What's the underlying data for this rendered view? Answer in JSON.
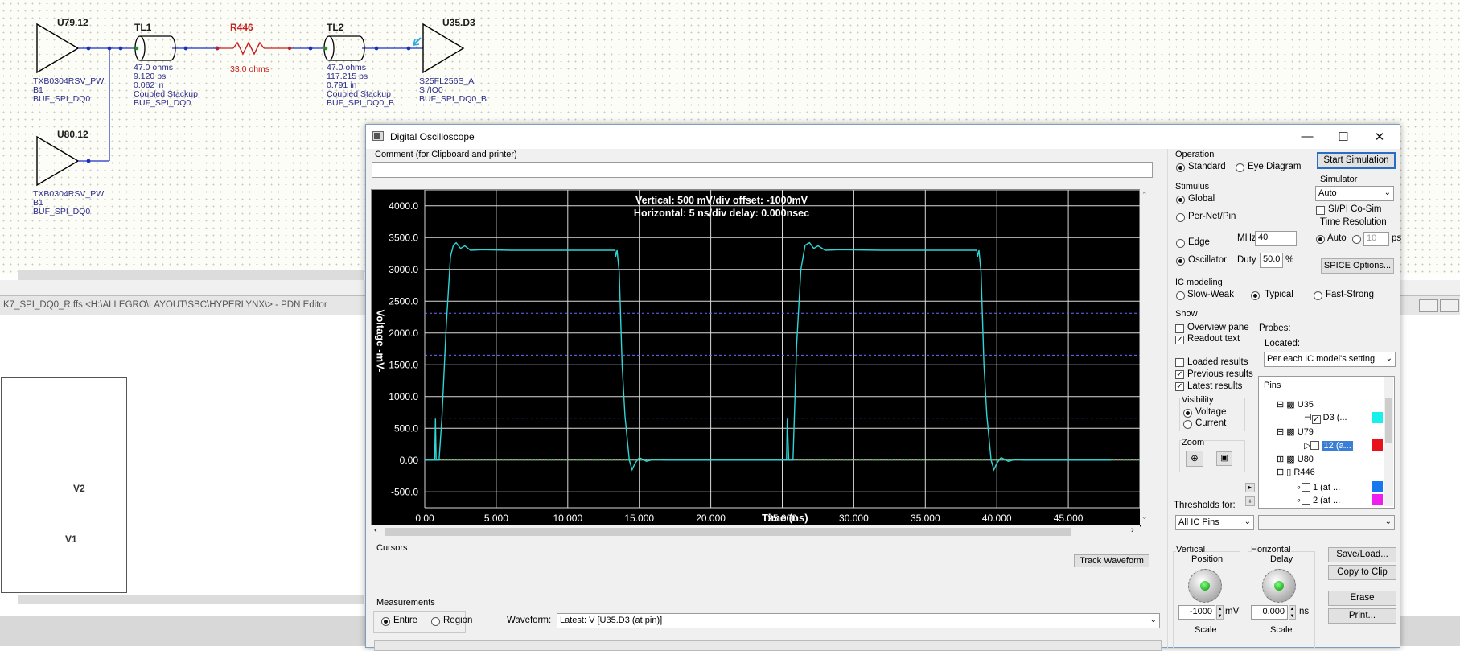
{
  "schematic": {
    "u79": {
      "ref": "U79.12",
      "model": "TXB0304RSV_PW",
      "pin": "B1",
      "net": "BUF_SPI_DQ0"
    },
    "u80": {
      "ref": "U80.12",
      "model": "TXB0304RSV_PW",
      "pin": "B1",
      "net": "BUF_SPI_DQ0"
    },
    "tl1": {
      "ref": "TL1",
      "impedance": "47.0 ohms",
      "delay": "9.120 ps",
      "length": "0.062 in",
      "type": "Coupled Stackup",
      "net": "BUF_SPI_DQ0"
    },
    "r446": {
      "ref": "R446",
      "value": "33.0 ohms"
    },
    "tl2": {
      "ref": "TL2",
      "impedance": "47.0 ohms",
      "delay": "117.215 ps",
      "length": "0.791 in",
      "type": "Coupled Stackup",
      "net": "BUF_SPI_DQ0_B"
    },
    "u35": {
      "ref": "U35.D3",
      "model": "S25FL256S_A",
      "pin": "SI/IO0",
      "net": "BUF_SPI_DQ0_B"
    }
  },
  "pdn_editor": {
    "title": "K7_SPI_DQ0_R.ffs <H:\\ALLEGRO\\LAYOUT\\SBC\\HYPERLYNX\\> - PDN Editor",
    "labels": [
      "V2",
      "V1"
    ]
  },
  "oscilloscope": {
    "title": "Digital Oscilloscope",
    "comment_label": "Comment (for Clipboard and printer)",
    "comment_value": "",
    "scope": {
      "vertical_readout": "Vertical: 500 mV/div  offset: -1000mV",
      "horizontal_readout": "Horizontal: 5 ns/div  delay: 0.000nsec",
      "ylabel": "Voltage  -mV-",
      "xlabel": "Time  (ns)"
    },
    "operation": {
      "label": "Operation",
      "standard": "Standard",
      "eye": "Eye Diagram"
    },
    "start_button": "Start Simulation",
    "simulator": {
      "label": "Simulator",
      "value": "Auto",
      "sipi": "SI/PI Co-Sim",
      "time_res_label": "Time Resolution",
      "auto": "Auto",
      "ps_value": "10",
      "ps_unit": "ps",
      "spice_button": "SPICE Options..."
    },
    "stimulus": {
      "label": "Stimulus",
      "global": "Global",
      "per_net": "Per-Net/Pin",
      "edge": "Edge",
      "oscillator": "Oscillator",
      "mhz_label": "MHz",
      "mhz_value": "40",
      "duty_label": "Duty",
      "duty_value": "50.0",
      "duty_unit": "%"
    },
    "ic_modeling": {
      "label": "IC modeling",
      "slow": "Slow-Weak",
      "typical": "Typical",
      "fast": "Fast-Strong"
    },
    "show": {
      "label": "Show",
      "overview": "Overview pane",
      "readout": "Readout text",
      "loaded": "Loaded results",
      "previous": "Previous results",
      "latest": "Latest results"
    },
    "probes": {
      "label": "Probes:",
      "located_label": "Located:",
      "located_value": "Per each IC model's setting",
      "pins_header": "Pins"
    },
    "tree": [
      {
        "text": "U35"
      },
      {
        "text": "D3 (..."
      },
      {
        "text": "U79"
      },
      {
        "text": "12 (a..."
      },
      {
        "text": "U80"
      },
      {
        "text": "R446"
      },
      {
        "text": "1 (at ..."
      },
      {
        "text": "2 (at ..."
      }
    ],
    "visibility": {
      "label": "Visibility",
      "voltage": "Voltage",
      "current": "Current"
    },
    "zoom_label": "Zoom",
    "thresholds": {
      "label": "Thresholds for:",
      "value": "All IC Pins"
    },
    "cursors": {
      "label": "Cursors",
      "track_button": "Track Waveform"
    },
    "measurements": {
      "label": "Measurements",
      "entire": "Entire",
      "region": "Region",
      "waveform_label": "Waveform:",
      "waveform_value": "Latest: V [U35.D3 (at pin)]"
    },
    "vertical": {
      "label1": "Vertical",
      "label2": "Position",
      "value": "-1000",
      "unit": "mV",
      "scale": "Scale"
    },
    "horizontal": {
      "label1": "Horizontal",
      "label2": "Delay",
      "value": "0.000",
      "unit": "ns",
      "scale": "Scale"
    },
    "buttons": {
      "save": "Save/Load...",
      "copy": "Copy to Clip",
      "erase": "Erase",
      "print": "Print..."
    },
    "colors": {
      "waveform": "#2fd6d6",
      "swatch_cyan": "#19f0ec",
      "swatch_red": "#e8101c",
      "swatch_blue": "#1677f0",
      "swatch_magenta": "#ee1eee"
    }
  },
  "chart_data": {
    "type": "line",
    "title": "",
    "xlabel": "Time  (ns)",
    "ylabel": "Voltage  -mV-",
    "xlim": [
      0,
      50
    ],
    "ylim": [
      -750,
      4250
    ],
    "x_ticks": [
      "0.00",
      "5.000",
      "10.000",
      "15.000",
      "20.000",
      "25.000",
      "30.000",
      "35.000",
      "40.000",
      "45.000"
    ],
    "y_ticks": [
      "4000.0",
      "3500.0",
      "3000.0",
      "2500.0",
      "2000.0",
      "1500.0",
      "1000.0",
      "500.0",
      "0.00",
      "-500.0"
    ],
    "threshold_lines_mv": [
      2310,
      1650,
      660
    ],
    "series": [
      {
        "x": [
          0,
          0.7,
          0.75,
          0.8,
          0.85,
          1.0,
          1.2,
          1.5,
          1.8,
          2.0,
          2.2,
          2.5,
          2.8,
          3.2,
          4.0,
          6.0,
          10.0,
          13.3,
          13.35,
          13.45,
          13.6,
          13.8,
          14.0,
          14.3,
          14.5,
          14.7,
          15.0,
          15.5,
          16.0,
          17.0,
          20.0,
          25.3,
          25.35,
          25.45,
          25.6,
          25.75,
          26.0,
          26.3,
          26.6,
          26.9,
          27.2,
          27.5,
          28.0,
          29.0,
          32.0,
          38.6,
          38.65,
          38.75,
          38.9,
          39.1,
          39.3,
          39.6,
          39.8,
          40.0,
          40.3,
          40.8,
          41.3,
          42.0,
          48
        ],
        "values": [
          0,
          0,
          650,
          0,
          0,
          0,
          650,
          2100,
          3200,
          3380,
          3420,
          3330,
          3370,
          3300,
          3310,
          3300,
          3300,
          3300,
          3200,
          3300,
          2950,
          1500,
          700,
          0,
          -150,
          -50,
          40,
          -20,
          10,
          0,
          0,
          0,
          650,
          0,
          0,
          0,
          1800,
          3000,
          3380,
          3420,
          3330,
          3370,
          3300,
          3310,
          3300,
          3300,
          3200,
          3300,
          2950,
          1500,
          700,
          0,
          -150,
          -50,
          40,
          -20,
          10,
          0,
          0
        ]
      }
    ]
  }
}
